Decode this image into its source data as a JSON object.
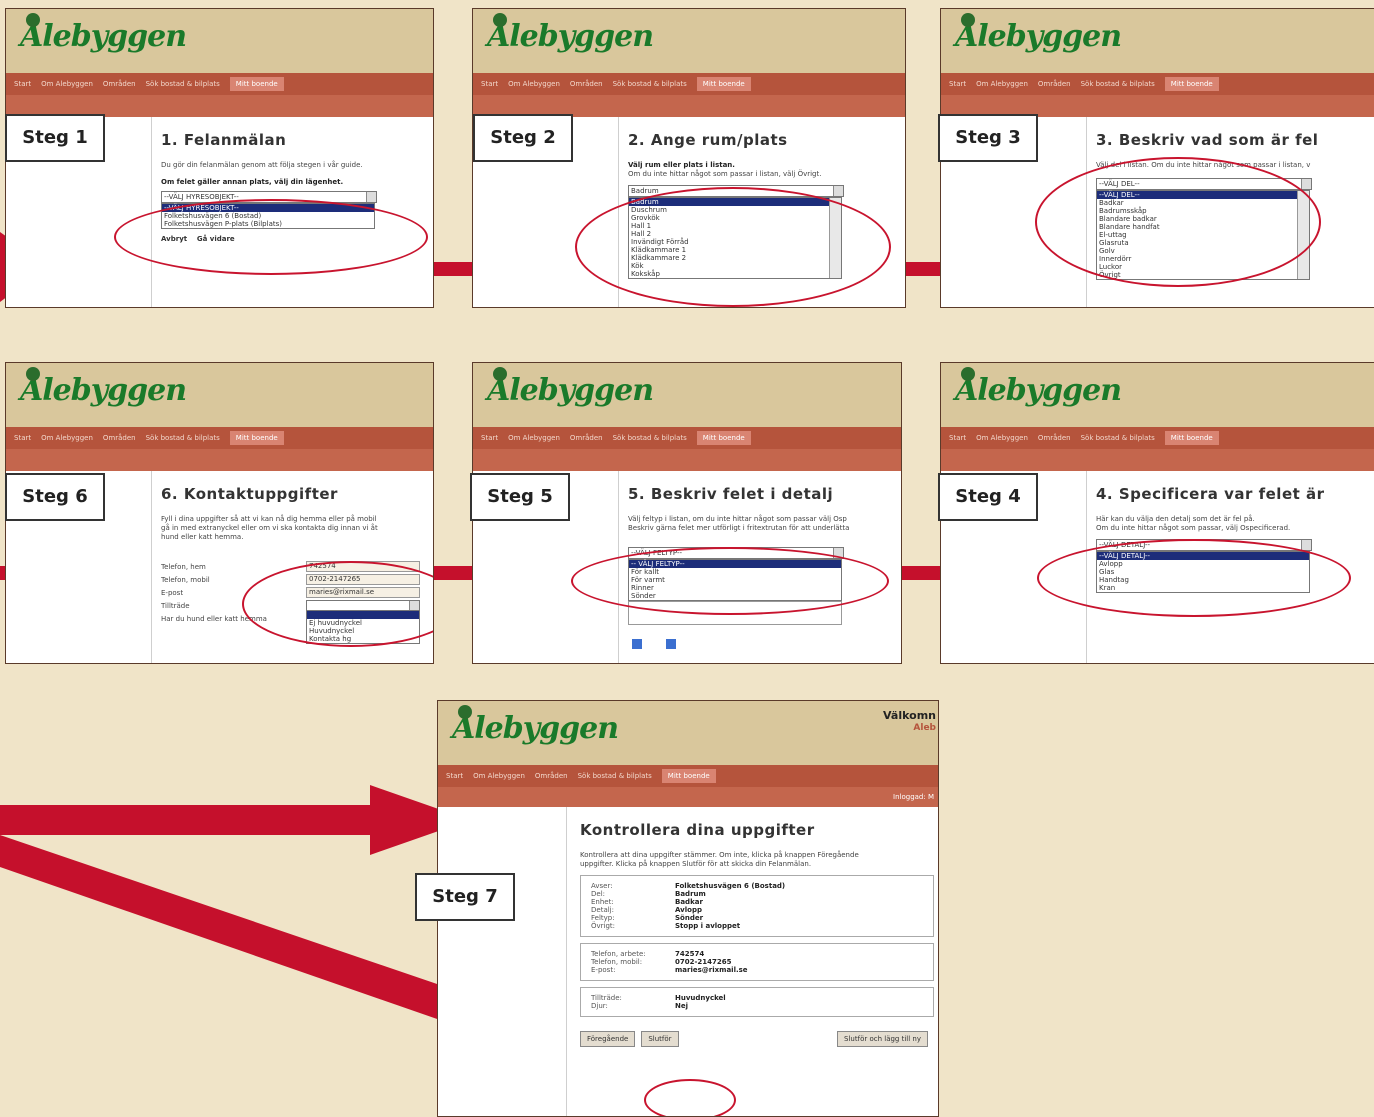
{
  "brand": {
    "logo": "Alebyggen"
  },
  "nav": {
    "items": [
      "Start",
      "Om Alebyggen",
      "Områden",
      "Sök bostad & bilplats",
      "Mitt boende"
    ]
  },
  "step1": {
    "badge": "Steg 1",
    "title": "1. Felanmälan",
    "intro": "Du gör din felanmälan genom att följa stegen i vår guide.",
    "instruction": "Om felet gäller annan plats, välj din lägenhet.",
    "select_value": "--VÄLJ HYRESOBJEKT--",
    "options": [
      "--VÄLJ HYRESOBJEKT--",
      "Folketshusvägen 6 (Bostad)",
      "Folketshusvägen P-plats (Bilplats)"
    ],
    "cancel": "Avbryt",
    "next": "Gå vidare"
  },
  "step2": {
    "badge": "Steg 2",
    "title": "2. Ange rum/plats",
    "instruction": "Välj rum eller plats i listan.",
    "hint": "Om du inte hittar något som passar i listan, välj Övrigt.",
    "select_value": "Badrum",
    "options": [
      "Badrum",
      "Duschrum",
      "Grovkök",
      "Hall 1",
      "Hall 2",
      "Invändigt Förråd",
      "Klädkammare 1",
      "Klädkammare 2",
      "Kök",
      "Kokskåp"
    ]
  },
  "step3": {
    "badge": "Steg 3",
    "title": "3. Beskriv vad som är fel",
    "hint": "Välj del i listan. Om du inte hittar något som passar i listan, v",
    "select_value": "--VÄLJ DEL--",
    "options": [
      "--VÄLJ DEL--",
      "Badkar",
      "Badrumsskåp",
      "Blandare badkar",
      "Blandare handfat",
      "El-uttag",
      "Glasruta",
      "Golv",
      "Innerdörr",
      "Luckor",
      "Övrigt"
    ]
  },
  "step4": {
    "badge": "Steg 4",
    "title": "4. Specificera var felet är",
    "hint1": "Här kan du välja den detalj som det är fel på.",
    "hint2": "Om du inte hittar något som passar, välj Ospecificerad.",
    "select_value": "--VÄLJ DETALJ--",
    "options": [
      "--VÄLJ DETALJ--",
      "Avlopp",
      "Glas",
      "Handtag",
      "Kran"
    ]
  },
  "step5": {
    "badge": "Steg 5",
    "title": "5. Beskriv felet i detalj",
    "hint1": "Välj feltyp i listan, om du inte hittar något som passar välj Osp",
    "hint2": "Beskriv gärna felet mer utförligt i fritextrutan för att underlätta",
    "select_value": "--VÄLJ FELTYP--",
    "options": [
      "-- VÄLJ FELTYP--",
      "För kallt",
      "För varmt",
      "Rinner",
      "Sönder"
    ]
  },
  "step6": {
    "badge": "Steg 6",
    "title": "6. Kontaktuppgifter",
    "intro1": "Fyll i dina uppgifter så att vi kan nå dig hemma eller på mobil",
    "intro2": "gå in med extranyckel eller om vi ska kontakta dig innan vi åt",
    "intro3": "hund eller katt hemma.",
    "fields": [
      {
        "label": "Telefon, hem",
        "value": "742574"
      },
      {
        "label": "Telefon, mobil",
        "value": "0702-2147265"
      },
      {
        "label": "E-post",
        "value": "maries@rixmail.se"
      },
      {
        "label": "Tillträde",
        "value": ""
      }
    ],
    "pet_question": "Har du hund eller katt hemma",
    "access_options": [
      "Ej huvudnyckel",
      "Huvudnyckel",
      "Kontakta hg"
    ]
  },
  "step7": {
    "badge": "Steg 7",
    "welcome": "Välkomn",
    "welcome_sub": "Aleb",
    "logged_in": "Inloggad: M",
    "title": "Kontrollera dina uppgifter",
    "intro1": "Kontrollera att dina uppgifter stämmer. Om inte, klicka på knappen Föregående",
    "intro2": "uppgifter. Klicka på knappen Slutför för att skicka din Felanmälan.",
    "summary1": [
      {
        "k": "Avser:",
        "v": "Folketshusvägen 6 (Bostad)"
      },
      {
        "k": "Del:",
        "v": "Badrum"
      },
      {
        "k": "Enhet:",
        "v": "Badkar"
      },
      {
        "k": "Detalj:",
        "v": "Avlopp"
      },
      {
        "k": "Feltyp:",
        "v": "Sönder"
      },
      {
        "k": "Övrigt:",
        "v": "Stopp i avloppet"
      }
    ],
    "summary2": [
      {
        "k": "Telefon, arbete:",
        "v": "742574"
      },
      {
        "k": "Telefon, mobil:",
        "v": "0702-2147265"
      },
      {
        "k": "E-post:",
        "v": "maries@rixmail.se"
      }
    ],
    "summary3": [
      {
        "k": "Tillträde:",
        "v": "Huvudnyckel"
      },
      {
        "k": "Djur:",
        "v": "Nej"
      }
    ],
    "btn_prev": "Föregående",
    "btn_finish": "Slutför",
    "btn_finish_new": "Slutför och lägg till ny"
  },
  "colors": {
    "accent_red": "#c5102c",
    "nav_bg": "#b5543c",
    "logo_green": "#1a7a2a",
    "background": "#f0e4c8"
  }
}
